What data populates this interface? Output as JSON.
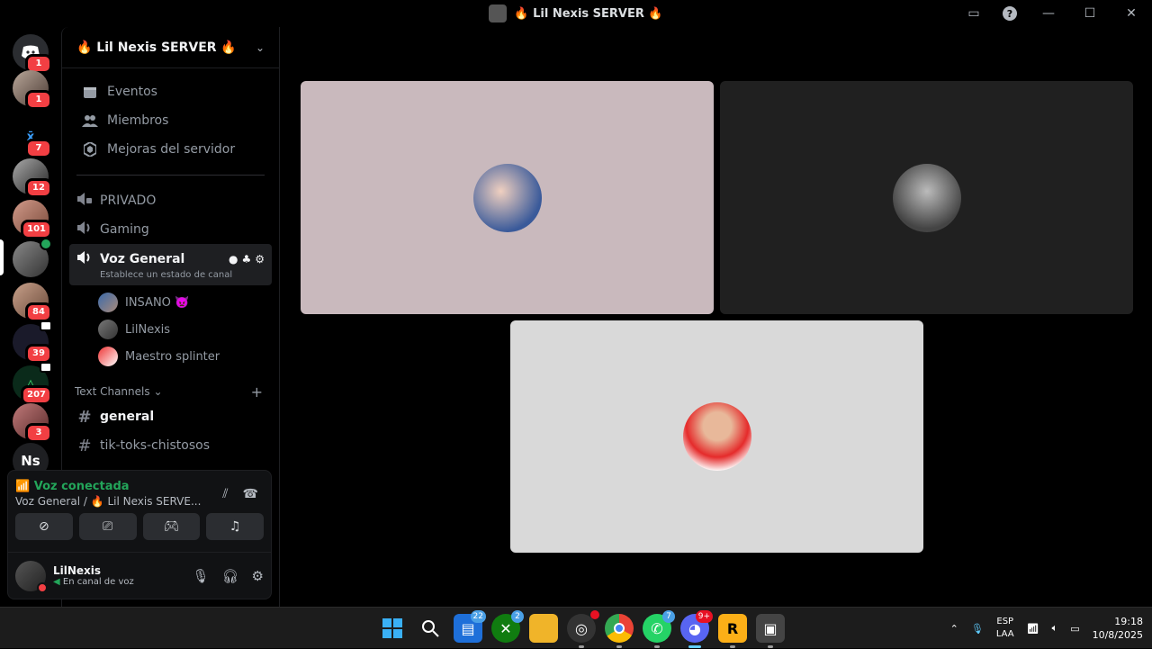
{
  "window": {
    "title": "🔥 Lil Nexis SERVER 🔥"
  },
  "rail": {
    "servers": [
      {
        "name": "discord-home",
        "badge": "1"
      },
      {
        "name": "dm-avatar",
        "badge": "1"
      },
      {
        "name": "server-x",
        "badge": "7"
      },
      {
        "name": "server-skull",
        "badge": "12"
      },
      {
        "name": "server-face",
        "badge": "101"
      },
      {
        "name": "server-lilnexis",
        "badge": ""
      },
      {
        "name": "server-boy",
        "badge": "84"
      },
      {
        "name": "server-stars",
        "badge": "39"
      },
      {
        "name": "server-triangle",
        "badge": "207"
      },
      {
        "name": "server-heart",
        "badge": "3"
      },
      {
        "name": "server-ns",
        "badge": ""
      }
    ],
    "ns_label": "Ns"
  },
  "sidebar": {
    "server_name": "🔥 Lil Nexis SERVER 🔥",
    "nav": [
      {
        "label": "Eventos",
        "icon": "calendar-icon"
      },
      {
        "label": "Miembros",
        "icon": "members-icon"
      },
      {
        "label": "Mejoras del servidor",
        "icon": "boost-icon"
      }
    ],
    "voice_channels": [
      {
        "label": "PRIVADO",
        "icon": "speaker-lock-icon"
      },
      {
        "label": "Gaming",
        "icon": "speaker-icon"
      }
    ],
    "active_channel": {
      "label": "Voz General",
      "status": "Establece un estado de canal"
    },
    "members": [
      {
        "name": "INSANO 👿"
      },
      {
        "name": "LilNexis"
      },
      {
        "name": "Maestro splinter"
      }
    ],
    "text_category": "Text Channels",
    "text_channels": [
      {
        "label": "general",
        "unread": true
      },
      {
        "label": "tik-toks-chistosos",
        "unread": false
      }
    ]
  },
  "voice_panel": {
    "status": "Voz conectada",
    "location": "Voz General / 🔥 Lil Nexis SERVE..."
  },
  "user": {
    "name": "LilNexis",
    "status": "En canal de voz"
  },
  "stage": {
    "tiles": [
      {
        "name": "tile-insano",
        "bg": "#c9b9bd"
      },
      {
        "name": "tile-lilnexis",
        "bg": "#202020"
      },
      {
        "name": "tile-maestro",
        "bg": "#d9d9d9"
      }
    ]
  },
  "taskbar": {
    "apps": [
      {
        "name": "start",
        "badge": ""
      },
      {
        "name": "search",
        "badge": ""
      },
      {
        "name": "widgets",
        "badge": "22"
      },
      {
        "name": "xbox",
        "badge": "2"
      },
      {
        "name": "explorer",
        "badge": ""
      },
      {
        "name": "obs",
        "badge": ""
      },
      {
        "name": "chrome",
        "badge": ""
      },
      {
        "name": "whatsapp",
        "badge": "7"
      },
      {
        "name": "discord",
        "badge": "9+"
      },
      {
        "name": "rockstar",
        "badge": ""
      },
      {
        "name": "gta",
        "badge": ""
      }
    ],
    "lang_top": "ESP",
    "lang_bottom": "LAA",
    "time": "19:18",
    "date": "10/8/2025"
  }
}
